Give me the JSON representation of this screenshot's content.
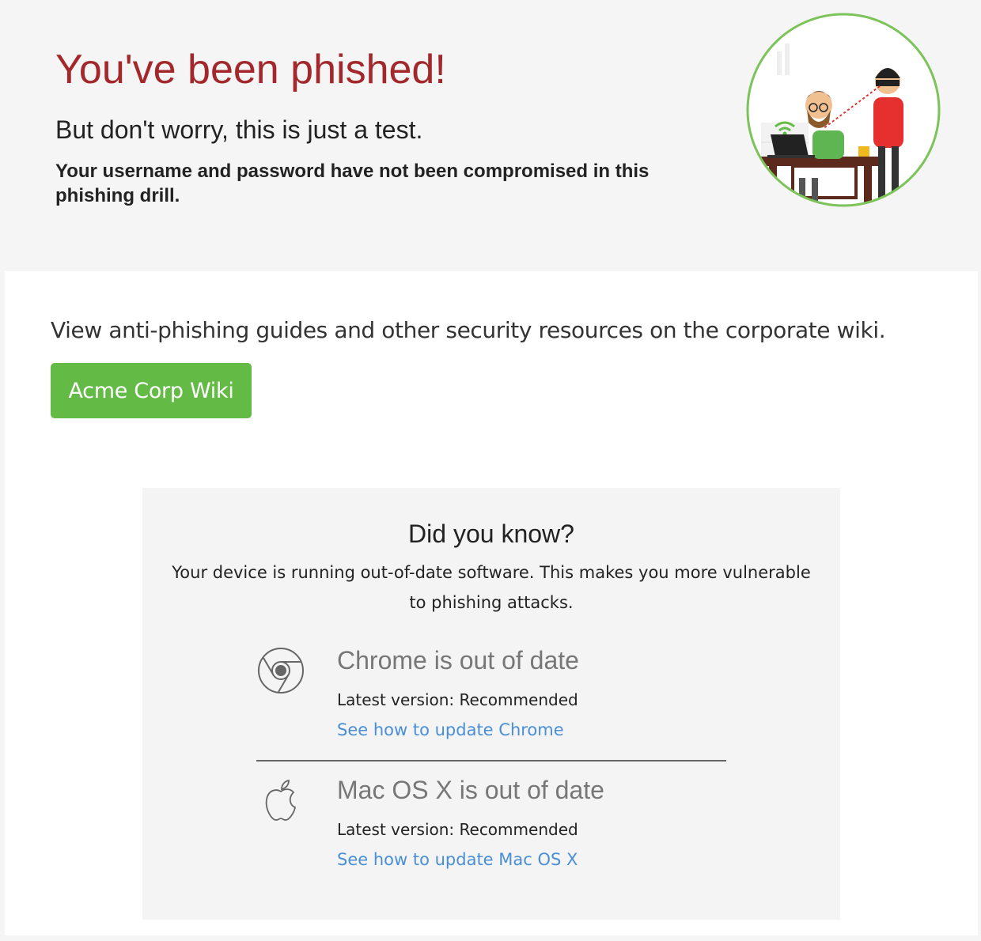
{
  "header": {
    "title": "You've been phished!",
    "subtitle": "But don't worry, this is just a test.",
    "note": "Your username and password have not been compromised in this phishing drill."
  },
  "main": {
    "intro": "View anti-phishing guides and other security resources on the corporate wiki.",
    "wiki_button_label": "Acme Corp Wiki"
  },
  "did_you_know": {
    "title": "Did you know?",
    "text": "Your device is running out-of-date software. This makes you more vulnerable to phishing attacks.",
    "items": [
      {
        "icon": "chrome-icon",
        "title": "Chrome is out of date",
        "version": "Latest version: Recommended",
        "link": "See how to update Chrome"
      },
      {
        "icon": "apple-icon",
        "title": "Mac OS X is out of date",
        "version": "Latest version: Recommended",
        "link": "See how to update Mac OS X"
      }
    ]
  },
  "colors": {
    "title": "#a3282c",
    "button": "#63bb45",
    "link": "#4a8fd6",
    "illustration_border": "#7cc35a"
  }
}
